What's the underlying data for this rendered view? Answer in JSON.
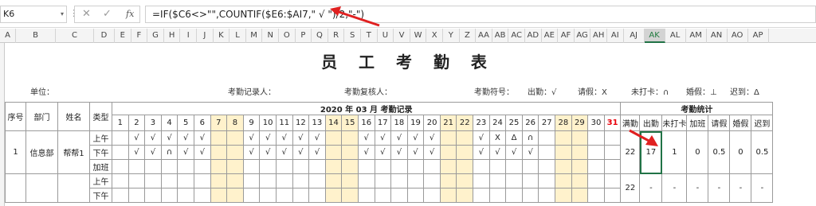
{
  "formula_bar": {
    "name_box": "K6",
    "name_box_arrow": "▾",
    "dots": "⋮",
    "cancel_icon": "✕",
    "enter_icon": "✓",
    "fx_label": "fx",
    "formula": "=IF($C6<>\"\",COUNTIF($E6:$AI7,\" √ \")/2,\"-\")"
  },
  "columns": [
    "A",
    "B",
    "C",
    "D",
    "E",
    "F",
    "G",
    "H",
    "I",
    "J",
    "K",
    "L",
    "M",
    "N",
    "O",
    "P",
    "Q",
    "R",
    "S",
    "T",
    "U",
    "V",
    "W",
    "X",
    "Y",
    "Z",
    "AA",
    "AB",
    "AC",
    "AD",
    "AE",
    "AF",
    "AG",
    "AH",
    "AI",
    "AJ",
    "AK",
    "AL",
    "AM",
    "AN",
    "AO",
    "AP"
  ],
  "selected_column": "AK",
  "title": "员 工 考 勤 表",
  "meta": {
    "unit": "单位：",
    "recorder": "考勤记录人：",
    "reviewer": "考勤复核人：",
    "symbol_label": "考勤符号：",
    "present": "出勤：√",
    "leave": "请假：X",
    "no_punch": "未打卡：∩",
    "marriage": "婚假：⊥",
    "late": "迟到：Δ"
  },
  "header": {
    "seq": "序号",
    "dept": "部门",
    "name": "姓名",
    "type": "类型",
    "year": "2020",
    "year_unit": "年",
    "month": "03",
    "month_unit": "月",
    "record": "考勤记录",
    "stats": "考勤统计",
    "stat_cols": [
      "满勤",
      "出勤",
      "未打卡",
      "加班",
      "请假",
      "婚假",
      "迟到"
    ]
  },
  "days": [
    "1",
    "2",
    "3",
    "4",
    "5",
    "6",
    "7",
    "8",
    "9",
    "10",
    "11",
    "12",
    "13",
    "14",
    "15",
    "16",
    "17",
    "18",
    "19",
    "20",
    "21",
    "22",
    "23",
    "24",
    "25",
    "26",
    "27",
    "28",
    "29",
    "30",
    "31"
  ],
  "weekend_days": [
    7,
    8,
    14,
    15,
    21,
    22,
    28,
    29
  ],
  "red_day": 31,
  "employees": [
    {
      "seq": "1",
      "dept": "信息部",
      "name": "帮帮1",
      "row_labels": [
        "上午",
        "下午",
        "加班"
      ],
      "am": [
        "",
        "√",
        "√",
        "√",
        "√",
        "√",
        "",
        "",
        "√",
        "√",
        "√",
        "√",
        "√",
        "",
        "",
        "√",
        "√",
        "√",
        "√",
        "√",
        "",
        "",
        "√",
        "X",
        "Δ",
        "∩",
        "",
        "",
        "",
        "",
        ""
      ],
      "pm": [
        "",
        "√",
        "√",
        "∩",
        "√",
        "√",
        "",
        "",
        "√",
        "√",
        "√",
        "√",
        "√",
        "",
        "",
        "√",
        "√",
        "√",
        "√",
        "√",
        "",
        "",
        "√",
        "√",
        "√",
        "√",
        "",
        "",
        "",
        "",
        ""
      ],
      "ot": [
        "",
        "",
        "",
        "",
        "",
        "",
        "",
        "",
        "",
        "",
        "",
        "",
        "",
        "",
        "",
        "",
        "",
        "",
        "",
        "",
        "",
        "",
        "",
        "",
        "",
        "",
        "",
        "",
        "",
        "",
        ""
      ],
      "stats": [
        "22",
        "17",
        "1",
        "0",
        "0.5",
        "0",
        "0.5"
      ]
    },
    {
      "seq": "",
      "dept": "",
      "name": "",
      "row_labels": [
        "上午",
        "下午"
      ],
      "stats": [
        "22",
        "-",
        "-",
        "-",
        "-",
        "-",
        "-"
      ]
    }
  ]
}
